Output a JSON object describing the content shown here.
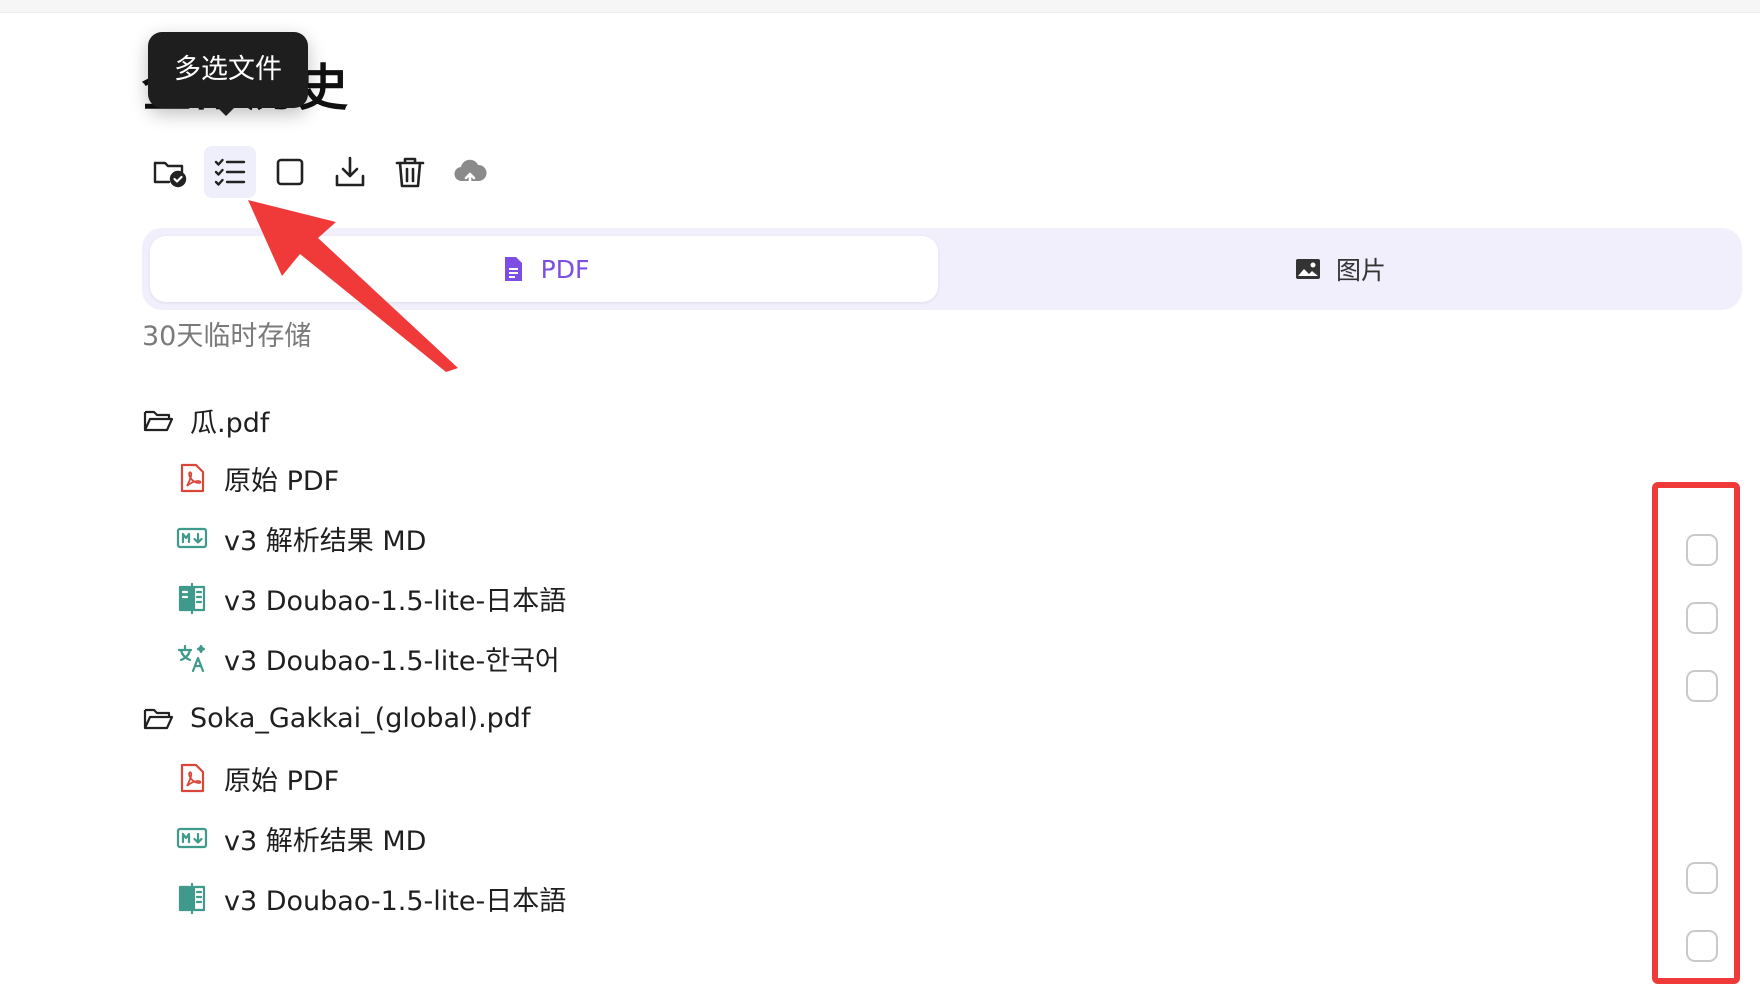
{
  "page_title": "全部历史",
  "tooltip": {
    "text": "多选文件"
  },
  "toolbar": {
    "buttons": [
      {
        "name": "folder-check",
        "icon": "folder-check-icon"
      },
      {
        "name": "multi-select",
        "icon": "list-check-icon",
        "active": true
      },
      {
        "name": "select-all",
        "icon": "square-icon"
      },
      {
        "name": "download",
        "icon": "download-icon"
      },
      {
        "name": "delete",
        "icon": "trash-icon"
      },
      {
        "name": "cloud-upload",
        "icon": "cloud-upload-icon"
      }
    ]
  },
  "tabs": [
    {
      "label": "PDF",
      "icon": "pdf-file-icon",
      "active": true
    },
    {
      "label": "图片",
      "icon": "image-icon",
      "active": false
    }
  ],
  "storage_note": "30天临时存储",
  "files": [
    {
      "folder": "瓜.pdf",
      "items": [
        {
          "label": "原始 PDF",
          "icon": "pdf-icon",
          "checkbox": false
        },
        {
          "label": "v3 解析结果 MD",
          "icon": "markdown-icon",
          "checkbox": true
        },
        {
          "label": "v3 Doubao-1.5-lite-日本語",
          "icon": "book-icon",
          "checkbox": true
        },
        {
          "label": "v3 Doubao-1.5-lite-한국어",
          "icon": "translate-icon",
          "checkbox": true
        }
      ]
    },
    {
      "folder": "Soka_Gakkai_(global).pdf",
      "items": [
        {
          "label": "原始 PDF",
          "icon": "pdf-icon",
          "checkbox": false
        },
        {
          "label": "v3 解析结果 MD",
          "icon": "markdown-icon",
          "checkbox": true
        },
        {
          "label": "v3 Doubao-1.5-lite-日本語",
          "icon": "book-icon",
          "checkbox": true
        }
      ]
    }
  ],
  "colors": {
    "accent": "#7c4ee4",
    "tab_bg": "#f1effb",
    "pdf_red": "#d9473b",
    "md_green": "#3f9a8c",
    "highlight_red": "#f03a3a"
  }
}
